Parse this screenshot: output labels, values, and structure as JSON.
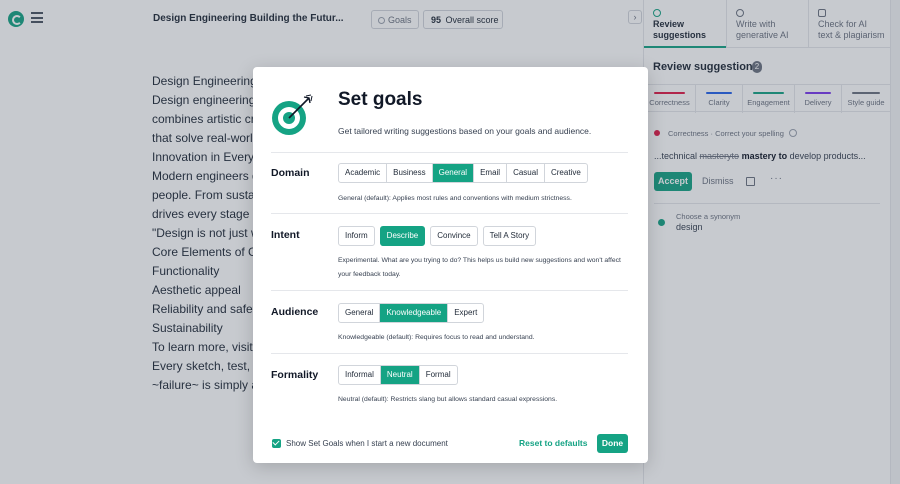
{
  "editor": {
    "doc_title": "Design Engineering Building the Futur...",
    "goals_label": "Goals",
    "score_value": "95",
    "score_label": "Overall score",
    "collapse_icon": "chevron-right-icon",
    "lines": [
      "Design Engineering: E",
      "Design engineering is",
      "combines artistic cre",
      "that solve real-world",
      "Innovation in Every D",
      "Modern engineers do",
      "people. From sustain",
      "drives every stage of",
      "\"Design is not just wh",
      "Core Elements of Gre",
      "Functionality",
      "Aesthetic appeal",
      "Reliability and safety",
      "Sustainability",
      "To learn more, visit E",
      "Every sketch, test, an",
      "~failure~ is simply an"
    ]
  },
  "panel": {
    "tabs": [
      {
        "line1": "Review",
        "line2": "suggestions"
      },
      {
        "line1": "Write with",
        "line2": "generative AI"
      },
      {
        "line1": "Check for AI",
        "line2": "text & plagiarism"
      }
    ],
    "title": "Review suggestions",
    "count": "2",
    "categories": [
      {
        "label": "Correctness",
        "color": "#e11d48"
      },
      {
        "label": "Clarity",
        "color": "#2563eb"
      },
      {
        "label": "Engagement",
        "color": "#15a384"
      },
      {
        "label": "Delivery",
        "color": "#7c3aed"
      },
      {
        "label": "Style guide",
        "color": "#6b7280"
      }
    ],
    "alert": {
      "category": "Correctness · Correct your spelling",
      "prefix": "...technical ",
      "wrong": "masteryto",
      "fix": "mastery to",
      "suffix": " develop products...",
      "accept": "Accept",
      "dismiss": "Dismiss",
      "more": "···"
    },
    "synonym": {
      "label": "Choose a synonym",
      "word": "design"
    }
  },
  "modal": {
    "title": "Set goals",
    "subtitle": "Get tailored writing suggestions based on your goals and audience.",
    "domain": {
      "label": "Domain",
      "options": [
        "Academic",
        "Business",
        "General",
        "Email",
        "Casual",
        "Creative"
      ],
      "selected": "General",
      "description": "General (default): Applies most rules and conventions with medium strictness."
    },
    "intent": {
      "label": "Intent",
      "options": [
        "Inform",
        "Describe",
        "Convince",
        "Tell A Story"
      ],
      "selected": "Describe",
      "description": "Experimental. What are you trying to do? This helps us build new suggestions and won't affect your feedback today."
    },
    "audience": {
      "label": "Audience",
      "options": [
        "General",
        "Knowledgeable",
        "Expert"
      ],
      "selected": "Knowledgeable",
      "description": "Knowledgeable (default): Requires focus to read and understand."
    },
    "formality": {
      "label": "Formality",
      "options": [
        "Informal",
        "Neutral",
        "Formal"
      ],
      "selected": "Neutral",
      "description": "Neutral (default): Restricts slang but allows standard casual expressions."
    },
    "show_checkbox": {
      "label": "Show Set Goals when I start a new document",
      "checked": true
    },
    "reset_label": "Reset to defaults",
    "done_label": "Done"
  },
  "colors": {
    "accent": "#15a384",
    "overlay": "rgba(55,65,81,0.28)"
  }
}
